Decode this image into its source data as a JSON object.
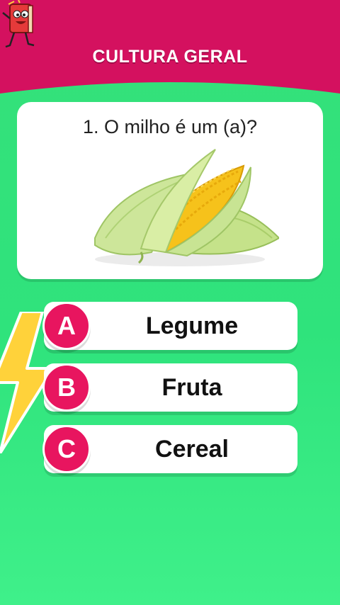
{
  "header": {
    "title": "CULTURA GERAL",
    "background_color": "#d4115f",
    "mascot_icon": "book-mascot-icon"
  },
  "question": {
    "text": "1. O milho é um (a)?",
    "image_icon": "corn-image"
  },
  "answers": [
    {
      "letter": "A",
      "label": "Legume"
    },
    {
      "letter": "B",
      "label": "Fruta"
    },
    {
      "letter": "C",
      "label": "Cereal"
    }
  ],
  "colors": {
    "background": "#35e07a",
    "accent": "#e8155f",
    "lightning": "#ffd23a"
  },
  "decorations": {
    "bolt_icon": "lightning-bolt-icon"
  }
}
